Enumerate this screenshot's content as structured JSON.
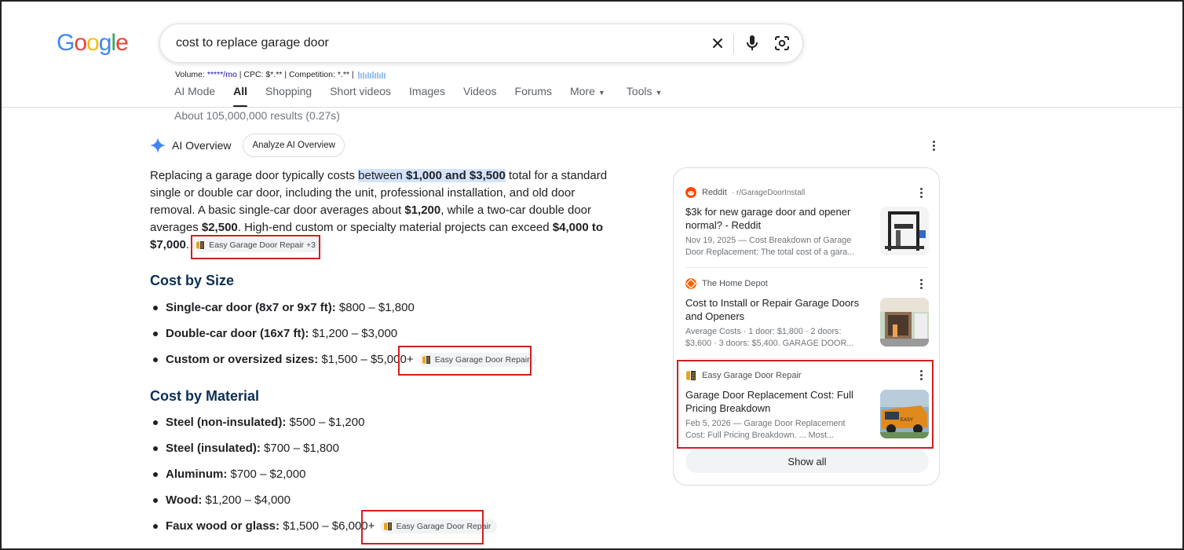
{
  "logo": {
    "g1": "G",
    "o1": "o",
    "o2": "o",
    "g2": "g",
    "l": "l",
    "e": "e"
  },
  "search": {
    "query": "cost to replace garage door"
  },
  "seo": {
    "volume_label": "Volume:",
    "volume_value": "*****/mo",
    "rest": "| CPC: $*.** | Competition: *.** |"
  },
  "nav": {
    "items": [
      "AI Mode",
      "All",
      "Shopping",
      "Short videos",
      "Images",
      "Videos",
      "Forums",
      "More",
      "Tools"
    ],
    "active": "All"
  },
  "result_stats": "About 105,000,000 results (0.27s)",
  "ai_overview": {
    "title": "AI Overview",
    "analyze_button": "Analyze AI Overview",
    "p1": "Replacing a garage door typically costs ",
    "p1_hl_a": "between ",
    "p1_hl_b": "$1,000 and $3,500",
    "p2": " total for a standard single or double car door, including the unit, professional installation, and old door removal. A basic single-car door averages about ",
    "p2_bold": "$1,200",
    "p3": ", while a two-car double door averages ",
    "p3_bold": "$2,500",
    "p4": ". High-end custom or specialty material projects can exceed ",
    "p4_bold": "$4,000 to $7,000",
    "p5": ".",
    "chip_main": "Easy Garage Door Repair +3"
  },
  "cost_by_size": {
    "heading": "Cost by Size",
    "items": [
      {
        "label": "Single-car door (8x7 or 9x7 ft):",
        "value": " $800 – $1,800"
      },
      {
        "label": "Double-car door (16x7 ft):",
        "value": " $1,200 – $3,000"
      },
      {
        "label": "Custom or oversized sizes:",
        "value": " $1,500 – $5,000+"
      }
    ],
    "chip": "Easy Garage Door Repair"
  },
  "cost_by_material": {
    "heading": "Cost by Material",
    "items": [
      {
        "label": "Steel (non-insulated):",
        "value": " $500 – $1,200"
      },
      {
        "label": "Steel (insulated):",
        "value": " $700 – $1,800"
      },
      {
        "label": "Aluminum:",
        "value": " $700 – $2,000"
      },
      {
        "label": "Wood:",
        "value": " $1,200 – $4,000"
      },
      {
        "label": "Faux wood or glass:",
        "value": " $1,500 – $6,000+"
      }
    ],
    "chip": "Easy Garage Door Repair"
  },
  "sources": [
    {
      "site": "Reddit",
      "sub": "· r/GarageDoorInstall",
      "title": "$3k for new garage door and opener normal? - Reddit",
      "snippet": "Nov 19, 2025 — Cost Breakdown of Garage Door Replacement: The total cost of a gara...",
      "icon_color": "#ff4500"
    },
    {
      "site": "The Home Depot",
      "sub": "",
      "title": "Cost to Install or Repair Garage Doors and Openers",
      "snippet": "Average Costs · 1 door: $1,800 · 2 doors: $3,600 · 3 doors: $5,400. GARAGE DOOR...",
      "icon_color": "#f96302"
    },
    {
      "site": "Easy Garage Door Repair",
      "sub": "",
      "title": "Garage Door Replacement Cost: Full Pricing Breakdown",
      "snippet": "Feb 5, 2026 — Garage Door Replacement Cost: Full Pricing Breakdown. ... Most...",
      "icon_color": "#e8a31c"
    }
  ],
  "show_all": "Show all",
  "colors": {
    "accent_blue": "#1a73e8",
    "highlight": "#d3e3fd",
    "annotation_red": "#d21f1f",
    "heading_navy": "#0b2f55"
  }
}
